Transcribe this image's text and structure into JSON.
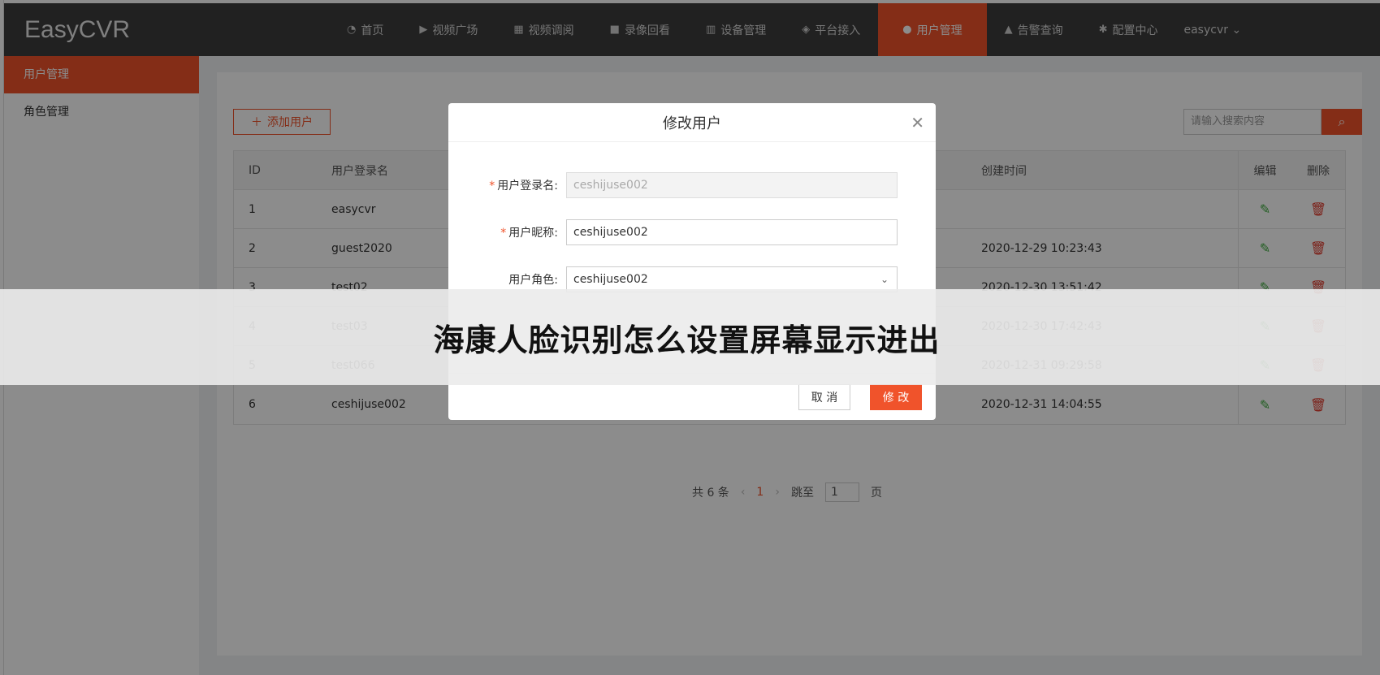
{
  "app": {
    "brand": "EasyCVR",
    "user": "easycvr ⌄"
  },
  "nav": [
    {
      "label": "首页",
      "icon": "dashboard-icon",
      "glyph": "◔"
    },
    {
      "label": "视频广场",
      "icon": "play-circle-icon",
      "glyph": "▶"
    },
    {
      "label": "视频调阅",
      "icon": "grid-icon",
      "glyph": "▦"
    },
    {
      "label": "录像回看",
      "icon": "video-camera-icon",
      "glyph": "■"
    },
    {
      "label": "设备管理",
      "icon": "columns-icon",
      "glyph": "▥"
    },
    {
      "label": "平台接入",
      "icon": "cube-icon",
      "glyph": "◈"
    },
    {
      "label": "用户管理",
      "icon": "user-gear-icon",
      "glyph": "●"
    },
    {
      "label": "告警查询",
      "icon": "alarm-icon",
      "glyph": "▲"
    },
    {
      "label": "配置中心",
      "icon": "gear-icon",
      "glyph": "✱"
    }
  ],
  "sidebar": {
    "items": [
      {
        "label": "用户管理"
      },
      {
        "label": "角色管理"
      }
    ]
  },
  "toolbar": {
    "add_label": "添加用户",
    "search_placeholder": "请输入搜索内容"
  },
  "table": {
    "headers": {
      "id": "ID",
      "name": "用户登录名",
      "time": "创建时间",
      "edit": "编辑",
      "del": "删除"
    },
    "rows": [
      {
        "id": "1",
        "name": "easycvr",
        "time": ""
      },
      {
        "id": "2",
        "name": "guest2020",
        "time": "2020-12-29 10:23:43"
      },
      {
        "id": "3",
        "name": "test02",
        "time": "2020-12-30 13:51:42"
      },
      {
        "id": "4",
        "name": "test03",
        "time": "2020-12-30 17:42:43"
      },
      {
        "id": "5",
        "name": "test066",
        "time": "2020-12-31 09:29:58"
      },
      {
        "id": "6",
        "name": "ceshijuse002",
        "time": "2020-12-31 14:04:55"
      }
    ]
  },
  "pager": {
    "total": "共 6 条",
    "current": "1",
    "jump": "跳至",
    "jump_value": "1",
    "page": "页"
  },
  "modal": {
    "title": "修改用户",
    "login_label": "用户登录名:",
    "login_value": "ceshijuse002",
    "nick_label": "用户昵称:",
    "nick_value": "ceshijuse002",
    "role_label": "用户角色:",
    "role_value": "ceshijuse002",
    "cancel": "取 消",
    "ok": "修 改"
  },
  "banner": {
    "text": "海康人脸识别怎么设置屏幕显示进出"
  },
  "colors": {
    "accent": "#f0532b",
    "topbar": "#3c3c3c",
    "edit": "#3caa3c",
    "delete": "#e0392b"
  }
}
